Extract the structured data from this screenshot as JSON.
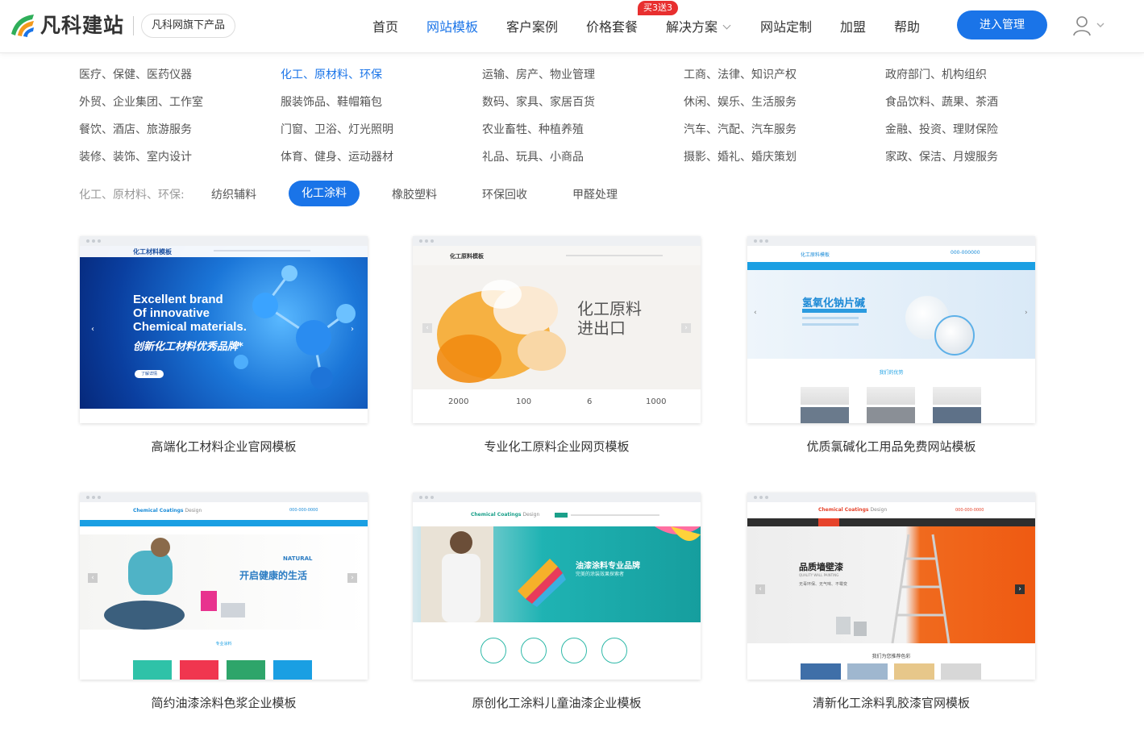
{
  "header": {
    "brand": "凡科建站",
    "sub_brand": "凡科网旗下产品",
    "nav": [
      {
        "label": "首页"
      },
      {
        "label": "网站模板"
      },
      {
        "label": "客户案例"
      },
      {
        "label": "价格套餐"
      },
      {
        "label": "解决方案"
      },
      {
        "label": "网站定制"
      },
      {
        "label": "加盟"
      },
      {
        "label": "帮助"
      }
    ],
    "badge": "买3送3",
    "manage_button": "进入管理",
    "user_icon": "user-icon"
  },
  "categories": [
    [
      "医疗、保健、医药仪器",
      "化工、原材料、环保",
      "运输、房产、物业管理",
      "工商、法律、知识产权",
      "政府部门、机构组织"
    ],
    [
      "外贸、企业集团、工作室",
      "服装饰品、鞋帽箱包",
      "数码、家具、家居百货",
      "休闲、娱乐、生活服务",
      "食品饮料、蔬果、茶酒"
    ],
    [
      "餐饮、酒店、旅游服务",
      "门窗、卫浴、灯光照明",
      "农业畜牲、种植养殖",
      "汽车、汽配、汽车服务",
      "金融、投资、理财保险"
    ],
    [
      "装修、装饰、室内设计",
      "体育、健身、运动器材",
      "礼品、玩具、小商品",
      "摄影、婚礼、婚庆策划",
      "家政、保洁、月嫂服务"
    ]
  ],
  "subcategory": {
    "label": "化工、原材料、环保:",
    "items": [
      "纺织辅料",
      "化工涂料",
      "橡胶塑料",
      "环保回收",
      "甲醛处理"
    ]
  },
  "templates": [
    {
      "title": "高端化工材料企业官网模板",
      "preview": {
        "site_name": "化工材料模板",
        "headline": [
          "Excellent brand",
          "Of innovative",
          "Chemical materials."
        ],
        "tagline": "创新化工材料优秀品牌*",
        "button": "了解详情"
      }
    },
    {
      "title": "专业化工原料企业网页模板",
      "preview": {
        "site_name": "化工原料模板",
        "headline": [
          "化工原料",
          "进出口"
        ],
        "stats": [
          "2000",
          "100",
          "6",
          "1000"
        ]
      }
    },
    {
      "title": "优质氯碱化工用品免费网站模板",
      "preview": {
        "site_name": "化工原料模板",
        "phone": "000-000000",
        "headline": "氢氧化钠片碱",
        "section": "我们的优势"
      }
    },
    {
      "title": "简约油漆涂料色浆企业模板",
      "preview": {
        "site_name": "Chemical Coatings",
        "site_name_suffix": "Design",
        "phone": "000-000-0000",
        "tag": "NATURAL",
        "headline": "开启健康的生活",
        "section": "专业涂料"
      }
    },
    {
      "title": "原创化工涂料儿童油漆企业模板",
      "preview": {
        "site_name": "Chemical Coatings",
        "site_name_suffix": "Design",
        "headline": "油漆涂料专业品牌",
        "sub": "完美的涂装效果探索者"
      }
    },
    {
      "title": "清新化工涂料乳胶漆官网模板",
      "preview": {
        "site_name": "Chemical Coatings",
        "site_name_suffix": "Design",
        "phone": "000-000-0000",
        "headline": "品质墙壁漆",
        "eng": "QUALITY WALL PAINTING",
        "sub": "无毒环保、无气味、不霉变",
        "section": "我们为您推荐色彩"
      }
    }
  ],
  "colors": {
    "accent": "#1a74e8",
    "badge": "#e82f2f",
    "text": "#333333",
    "muted": "#999999"
  }
}
